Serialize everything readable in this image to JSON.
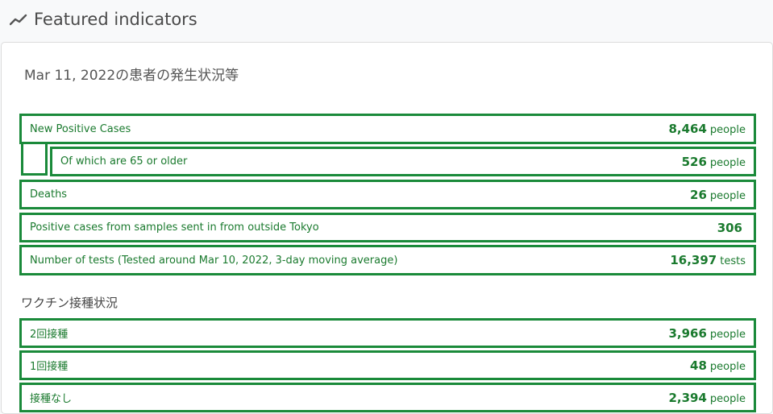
{
  "header": {
    "title": "Featured indicators",
    "icon": "trend-line-icon"
  },
  "card": {
    "date_title": "Mar 11, 2022の患者の発生状況等",
    "rows": [
      {
        "label": "New Positive Cases",
        "value": "8,464",
        "unit": "people"
      },
      {
        "label": "Of which are 65 or older",
        "value": "526",
        "unit": "people"
      },
      {
        "label": "Deaths",
        "value": "26",
        "unit": "people"
      },
      {
        "label": "Positive cases from samples sent in from outside Tokyo",
        "value": "306",
        "unit": ""
      },
      {
        "label": "Number of tests (Tested around Mar 10, 2022, 3-day moving average)",
        "value": "16,397",
        "unit": "tests"
      }
    ],
    "vaccination": {
      "heading": "ワクチン接種状況",
      "rows": [
        {
          "label": "2回接種",
          "value": "3,966",
          "unit": "people"
        },
        {
          "label": "1回接種",
          "value": "48",
          "unit": "people"
        },
        {
          "label": "接種なし",
          "value": "2,394",
          "unit": "people"
        }
      ]
    }
  },
  "colors": {
    "accent_green": "#1a8a3a",
    "text_green": "#1a7a2e"
  }
}
